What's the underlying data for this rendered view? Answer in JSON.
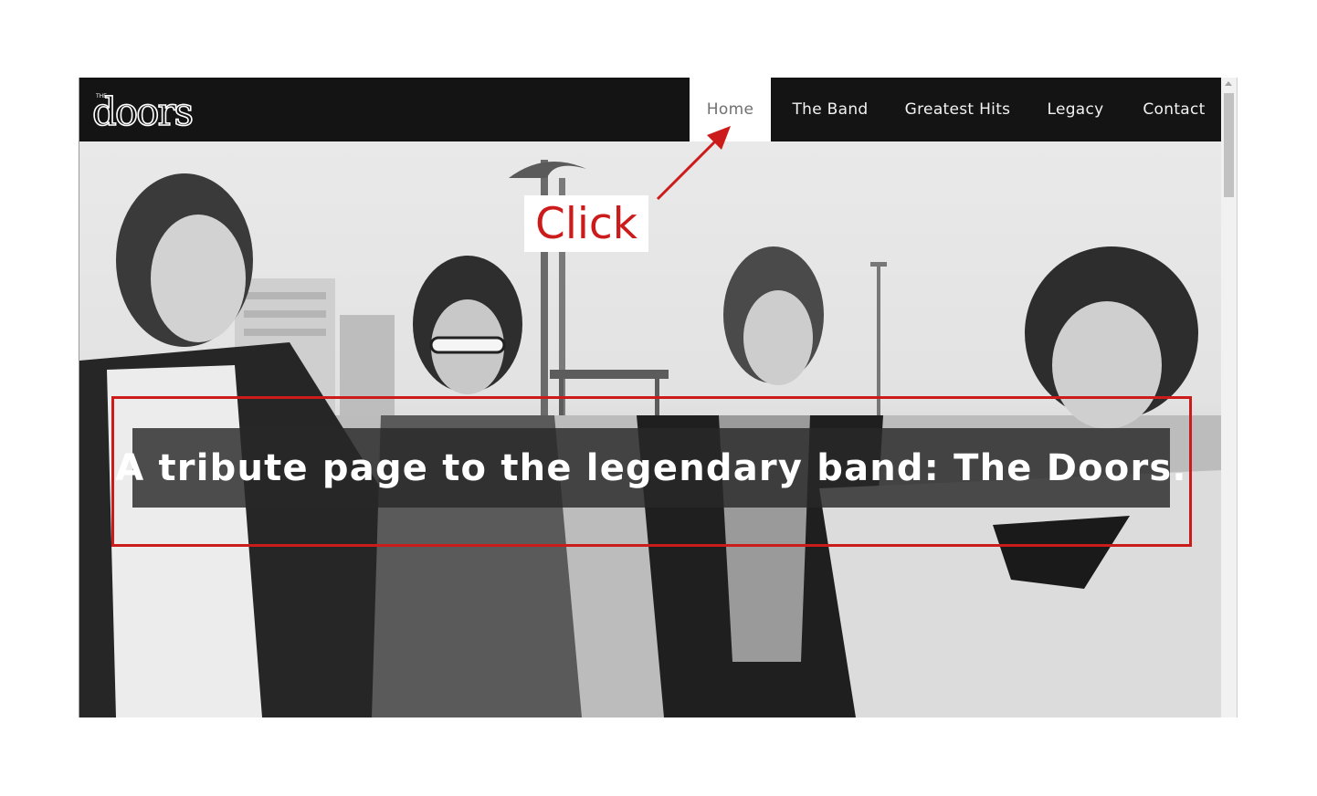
{
  "brand": {
    "logo_alt": "The Doors logo",
    "logo_small": "THE",
    "logo_text": "doors"
  },
  "nav": {
    "items": [
      {
        "label": "Home",
        "active": true
      },
      {
        "label": "The Band",
        "active": false
      },
      {
        "label": "Greatest Hits",
        "active": false
      },
      {
        "label": "Legacy",
        "active": false
      },
      {
        "label": "Contact",
        "active": false
      }
    ]
  },
  "hero": {
    "tagline": "A tribute page to the legendary band: The Doors."
  },
  "annotation": {
    "click_label": "Click",
    "color": "#cc1b1b"
  },
  "colors": {
    "navbar_bg": "#141414",
    "nav_text": "#f2f2f2",
    "nav_active_bg": "#ffffff",
    "nav_active_text": "#707070",
    "tagline_bg": "#282828"
  }
}
